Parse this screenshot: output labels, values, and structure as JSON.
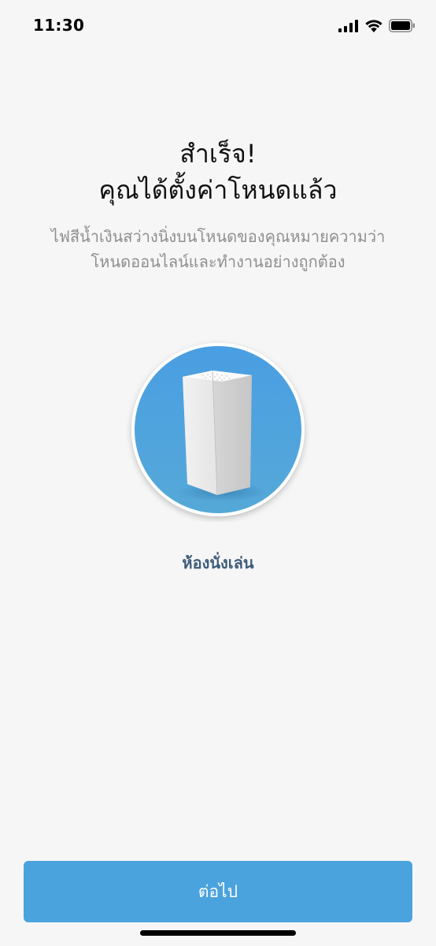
{
  "status_bar": {
    "time": "11:30"
  },
  "success": {
    "title_line1": "สำเร็จ!",
    "title_line2": "คุณได้ตั้งค่าโหนดแล้ว",
    "description_line1": "ไฟสีน้ำเงินสว่างนิ่งบนโหนดของคุณหมายความว่า",
    "description_line2": "โหนดออนไลน์และทำงานอย่างถูกต้อง"
  },
  "device": {
    "name": "ห้องนั่งเล่น",
    "icon": "router-node-icon"
  },
  "actions": {
    "next_label": "ต่อไป"
  },
  "colors": {
    "accent": "#4ba3dd",
    "device_label": "#3e5d7a",
    "background": "#f6f6f6"
  }
}
